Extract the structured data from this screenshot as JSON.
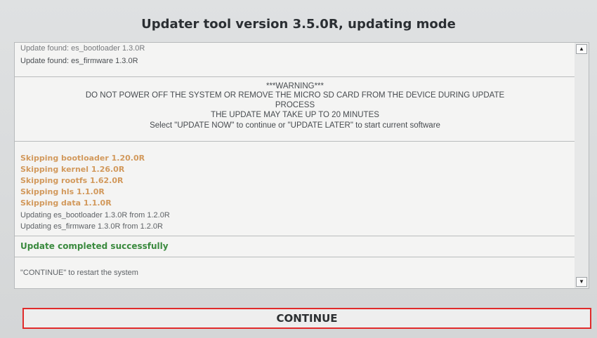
{
  "window": {
    "title": "Updater tool version 3.5.0R, updating mode"
  },
  "log": {
    "found_lines": [
      "Update found: es_bootloader 1.3.0R",
      "Update found: es_firmware 1.3.0R"
    ],
    "warning_lines": [
      "***WARNING***",
      "DO NOT POWER OFF THE SYSTEM OR REMOVE THE MICRO SD CARD FROM THE DEVICE DURING UPDATE",
      "PROCESS",
      "THE UPDATE MAY TAKE UP TO 20 MINUTES",
      "Select \"UPDATE NOW\" to continue or \"UPDATE LATER\" to start current software"
    ],
    "skipping_lines": [
      "Skipping bootloader 1.20.0R",
      "Skipping kernel 1.26.0R",
      "Skipping rootfs 1.62.0R",
      "Skipping hls 1.1.0R",
      "Skipping data 1.1.0R"
    ],
    "updating_lines": [
      "Updating es_bootloader 1.3.0R from 1.2.0R",
      "Updating es_firmware 1.3.0R from 1.2.0R"
    ],
    "success": "Update completed successfully",
    "restart_hint": "\"CONTINUE\" to restart the system"
  },
  "scrollbar": {
    "up_icon": "▲",
    "down_icon": "▼"
  },
  "actions": {
    "continue_label": "CONTINUE"
  },
  "colors": {
    "skipping": "#d2995c",
    "success": "#3a8a3e",
    "highlight": "#e02b2b"
  }
}
